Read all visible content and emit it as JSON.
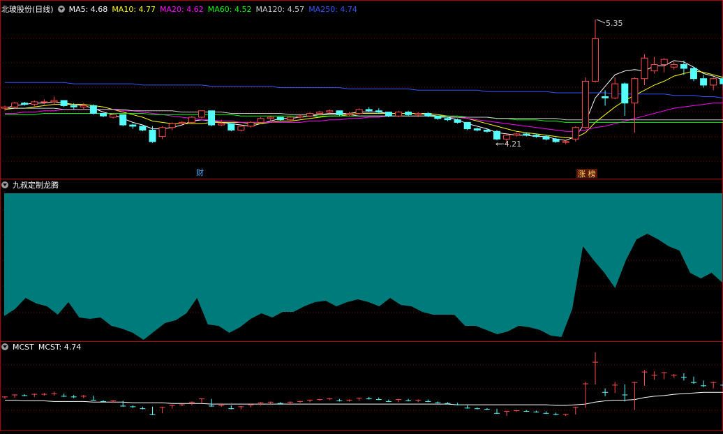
{
  "main_panel": {
    "stock_name": "北玻股份(日线)",
    "ma_items": [
      {
        "label": "MA5: 4.68",
        "color": "#ffffff"
      },
      {
        "label": "MA10: 4.77",
        "color": "#ffff00"
      },
      {
        "label": "MA20: 4.62",
        "color": "#ff00ff"
      },
      {
        "label": "MA60: 4.52",
        "color": "#00ff00"
      },
      {
        "label": "MA120: 4.57",
        "color": "#cccccc"
      },
      {
        "label": "MA250: 4.74",
        "color": "#3355ff"
      }
    ],
    "annotations": {
      "high_label": "5.35",
      "low_label": "4.21",
      "event_cai": "财",
      "event_zhangbang": "涨 榜"
    }
  },
  "mid_panel": {
    "title": "九叔定制龙腾"
  },
  "bottom_panel": {
    "title": "MCST",
    "value_label": "MCST: 4.74"
  },
  "colors": {
    "up": "#ff4b4b",
    "down": "#54ffff",
    "fill": "#007b7b",
    "grid": "#8a0000",
    "divider": "#b40000"
  },
  "chart_data": {
    "type": "candlestick",
    "price_high": 5.35,
    "price_low": 4.21,
    "ohlc": [
      [
        4.66,
        4.68,
        4.64,
        4.67
      ],
      [
        4.67,
        4.71,
        4.66,
        4.7
      ],
      [
        4.7,
        4.71,
        4.68,
        4.69
      ],
      [
        4.69,
        4.72,
        4.67,
        4.71
      ],
      [
        4.71,
        4.73,
        4.69,
        4.71
      ],
      [
        4.71,
        4.75,
        4.69,
        4.72
      ],
      [
        4.72,
        4.72,
        4.67,
        4.68
      ],
      [
        4.68,
        4.7,
        4.65,
        4.67
      ],
      [
        4.67,
        4.7,
        4.65,
        4.68
      ],
      [
        4.68,
        4.69,
        4.61,
        4.62
      ],
      [
        4.62,
        4.62,
        4.59,
        4.6
      ],
      [
        4.59,
        4.62,
        4.58,
        4.61
      ],
      [
        4.61,
        4.61,
        4.52,
        4.53
      ],
      [
        4.53,
        4.54,
        4.5,
        4.52
      ],
      [
        4.52,
        4.52,
        4.48,
        4.49
      ],
      [
        4.49,
        4.52,
        4.39,
        4.4
      ],
      [
        4.44,
        4.52,
        4.42,
        4.51
      ],
      [
        4.51,
        4.55,
        4.49,
        4.54
      ],
      [
        4.54,
        4.56,
        4.53,
        4.55
      ],
      [
        4.55,
        4.6,
        4.54,
        4.59
      ],
      [
        4.59,
        4.64,
        4.58,
        4.64
      ],
      [
        4.64,
        4.64,
        4.52,
        4.53
      ],
      [
        4.53,
        4.57,
        4.52,
        4.54
      ],
      [
        4.54,
        4.54,
        4.48,
        4.49
      ],
      [
        4.49,
        4.53,
        4.48,
        4.52
      ],
      [
        4.52,
        4.56,
        4.51,
        4.55
      ],
      [
        4.55,
        4.59,
        4.54,
        4.58
      ],
      [
        4.58,
        4.6,
        4.56,
        4.59
      ],
      [
        4.59,
        4.59,
        4.56,
        4.57
      ],
      [
        4.57,
        4.6,
        4.56,
        4.59
      ],
      [
        4.59,
        4.61,
        4.58,
        4.6
      ],
      [
        4.6,
        4.63,
        4.59,
        4.62
      ],
      [
        4.62,
        4.64,
        4.61,
        4.63
      ],
      [
        4.63,
        4.65,
        4.62,
        4.64
      ],
      [
        4.64,
        4.64,
        4.6,
        4.61
      ],
      [
        4.61,
        4.63,
        4.6,
        4.62
      ],
      [
        4.62,
        4.66,
        4.61,
        4.65
      ],
      [
        4.65,
        4.67,
        4.63,
        4.64
      ],
      [
        4.64,
        4.66,
        4.62,
        4.63
      ],
      [
        4.63,
        4.63,
        4.59,
        4.6
      ],
      [
        4.6,
        4.64,
        4.59,
        4.63
      ],
      [
        4.63,
        4.64,
        4.6,
        4.61
      ],
      [
        4.61,
        4.63,
        4.59,
        4.62
      ],
      [
        4.62,
        4.63,
        4.59,
        4.6
      ],
      [
        4.6,
        4.6,
        4.57,
        4.58
      ],
      [
        4.58,
        4.59,
        4.56,
        4.57
      ],
      [
        4.57,
        4.58,
        4.54,
        4.55
      ],
      [
        4.55,
        4.55,
        4.49,
        4.5
      ],
      [
        4.5,
        4.51,
        4.48,
        4.49
      ],
      [
        4.49,
        4.5,
        4.47,
        4.48
      ],
      [
        4.48,
        4.49,
        4.41,
        4.42
      ],
      [
        4.42,
        4.46,
        4.38,
        4.45
      ],
      [
        4.45,
        4.47,
        4.44,
        4.46
      ],
      [
        4.46,
        4.47,
        4.44,
        4.45
      ],
      [
        4.45,
        4.46,
        4.43,
        4.44
      ],
      [
        4.44,
        4.45,
        4.41,
        4.42
      ],
      [
        4.42,
        4.43,
        4.39,
        4.4
      ],
      [
        4.4,
        4.41,
        4.38,
        4.4
      ],
      [
        4.42,
        4.52,
        4.4,
        4.51
      ],
      [
        4.51,
        4.9,
        4.5,
        4.87
      ],
      [
        4.87,
        5.35,
        4.86,
        5.2
      ],
      [
        4.75,
        4.8,
        4.68,
        4.74
      ],
      [
        4.74,
        4.9,
        4.73,
        4.85
      ],
      [
        4.85,
        4.86,
        4.6,
        4.7
      ],
      [
        4.7,
        4.9,
        4.47,
        4.89
      ],
      [
        4.89,
        5.08,
        4.84,
        5.05
      ],
      [
        4.95,
        5.06,
        4.93,
        5.0
      ],
      [
        5.0,
        5.05,
        4.94,
        5.04
      ],
      [
        4.98,
        5.02,
        4.96,
        5.0
      ],
      [
        5.0,
        5.03,
        4.92,
        4.97
      ],
      [
        4.97,
        4.98,
        4.87,
        4.89
      ],
      [
        4.89,
        4.92,
        4.82,
        4.84
      ],
      [
        4.84,
        4.9,
        4.8,
        4.89
      ],
      [
        4.89,
        4.92,
        4.8,
        4.85
      ]
    ],
    "ma_values": {
      "MA5": [
        4.66,
        4.68,
        4.69,
        4.7,
        4.7,
        4.71,
        4.7,
        4.69,
        4.68,
        4.66,
        4.63,
        4.61,
        4.58,
        4.55,
        4.53,
        4.5,
        4.5,
        4.51,
        4.53,
        4.56,
        4.57,
        4.56,
        4.55,
        4.54,
        4.53,
        4.52,
        4.54,
        4.56,
        4.58,
        4.58,
        4.59,
        4.6,
        4.61,
        4.62,
        4.62,
        4.62,
        4.63,
        4.63,
        4.63,
        4.62,
        4.62,
        4.62,
        4.62,
        4.61,
        4.6,
        4.59,
        4.57,
        4.54,
        4.52,
        4.5,
        4.47,
        4.46,
        4.45,
        4.45,
        4.44,
        4.44,
        4.42,
        4.41,
        4.44,
        4.55,
        4.74,
        4.83,
        4.92,
        4.95,
        4.96,
        4.95,
        4.99,
        4.99,
        5.03,
        5.02,
        4.98,
        4.93,
        4.91,
        4.88
      ],
      "MA10": [
        4.65,
        4.66,
        4.66,
        4.67,
        4.68,
        4.69,
        4.69,
        4.69,
        4.69,
        4.68,
        4.67,
        4.65,
        4.63,
        4.61,
        4.59,
        4.56,
        4.55,
        4.54,
        4.54,
        4.54,
        4.54,
        4.55,
        4.55,
        4.55,
        4.55,
        4.54,
        4.54,
        4.55,
        4.56,
        4.56,
        4.57,
        4.58,
        4.59,
        4.6,
        4.6,
        4.61,
        4.62,
        4.62,
        4.62,
        4.62,
        4.62,
        4.62,
        4.62,
        4.62,
        4.61,
        4.6,
        4.59,
        4.58,
        4.56,
        4.54,
        4.52,
        4.5,
        4.48,
        4.47,
        4.46,
        4.45,
        4.44,
        4.43,
        4.43,
        4.47,
        4.55,
        4.61,
        4.67,
        4.72,
        4.76,
        4.8,
        4.84,
        4.87,
        4.91,
        4.93,
        4.95,
        4.94,
        4.92,
        4.9
      ],
      "MA20": [
        4.62,
        4.62,
        4.63,
        4.63,
        4.64,
        4.64,
        4.65,
        4.65,
        4.65,
        4.65,
        4.65,
        4.65,
        4.64,
        4.64,
        4.63,
        4.62,
        4.61,
        4.6,
        4.59,
        4.58,
        4.57,
        4.57,
        4.56,
        4.56,
        4.55,
        4.55,
        4.55,
        4.55,
        4.55,
        4.55,
        4.55,
        4.56,
        4.56,
        4.57,
        4.57,
        4.58,
        4.58,
        4.59,
        4.59,
        4.6,
        4.6,
        4.6,
        4.6,
        4.6,
        4.6,
        4.6,
        4.59,
        4.58,
        4.57,
        4.56,
        4.55,
        4.54,
        4.53,
        4.52,
        4.51,
        4.5,
        4.49,
        4.48,
        4.48,
        4.49,
        4.51,
        4.52,
        4.54,
        4.56,
        4.58,
        4.6,
        4.62,
        4.64,
        4.66,
        4.67,
        4.68,
        4.69,
        4.7,
        4.7
      ],
      "MA60": [
        4.61,
        4.61,
        4.61,
        4.61,
        4.62,
        4.62,
        4.62,
        4.62,
        4.62,
        4.62,
        4.62,
        4.62,
        4.62,
        4.62,
        4.62,
        4.61,
        4.61,
        4.61,
        4.61,
        4.61,
        4.61,
        4.61,
        4.61,
        4.61,
        4.6,
        4.6,
        4.6,
        4.6,
        4.6,
        4.6,
        4.6,
        4.6,
        4.6,
        4.6,
        4.6,
        4.6,
        4.6,
        4.6,
        4.6,
        4.6,
        4.6,
        4.6,
        4.6,
        4.6,
        4.6,
        4.6,
        4.6,
        4.59,
        4.59,
        4.59,
        4.58,
        4.58,
        4.57,
        4.57,
        4.57,
        4.56,
        4.56,
        4.55,
        4.55,
        4.55,
        4.55,
        4.55,
        4.55,
        4.55,
        4.55,
        4.55,
        4.55,
        4.55,
        4.55,
        4.55,
        4.55,
        4.55,
        4.55,
        4.55
      ],
      "MA120": [
        4.66,
        4.66,
        4.66,
        4.66,
        4.66,
        4.66,
        4.65,
        4.65,
        4.65,
        4.65,
        4.65,
        4.65,
        4.65,
        4.64,
        4.64,
        4.64,
        4.64,
        4.64,
        4.63,
        4.63,
        4.63,
        4.63,
        4.63,
        4.62,
        4.62,
        4.62,
        4.62,
        4.62,
        4.62,
        4.61,
        4.61,
        4.61,
        4.61,
        4.61,
        4.61,
        4.61,
        4.6,
        4.6,
        4.6,
        4.6,
        4.6,
        4.6,
        4.6,
        4.6,
        4.59,
        4.59,
        4.59,
        4.59,
        4.59,
        4.59,
        4.58,
        4.58,
        4.58,
        4.58,
        4.58,
        4.58,
        4.58,
        4.57,
        4.57,
        4.57,
        4.57,
        4.57,
        4.57,
        4.57,
        4.57,
        4.57,
        4.57,
        4.57,
        4.57,
        4.57,
        4.57,
        4.57,
        4.57,
        4.57
      ],
      "MA250": [
        4.86,
        4.86,
        4.86,
        4.86,
        4.86,
        4.86,
        4.86,
        4.85,
        4.85,
        4.85,
        4.85,
        4.85,
        4.85,
        4.85,
        4.84,
        4.84,
        4.84,
        4.84,
        4.84,
        4.84,
        4.84,
        4.83,
        4.83,
        4.83,
        4.83,
        4.83,
        4.83,
        4.83,
        4.82,
        4.82,
        4.82,
        4.82,
        4.82,
        4.82,
        4.82,
        4.81,
        4.81,
        4.81,
        4.81,
        4.81,
        4.81,
        4.81,
        4.8,
        4.8,
        4.8,
        4.8,
        4.8,
        4.8,
        4.8,
        4.79,
        4.79,
        4.79,
        4.79,
        4.79,
        4.79,
        4.79,
        4.78,
        4.78,
        4.78,
        4.78,
        4.78,
        4.78,
        4.77,
        4.77,
        4.77,
        4.77,
        4.77,
        4.77,
        4.76,
        4.76,
        4.76,
        4.75,
        4.75,
        4.74
      ]
    },
    "longteng_values": [
      0.17,
      0.22,
      0.3,
      0.26,
      0.24,
      0.18,
      0.27,
      0.16,
      0.15,
      0.16,
      0.1,
      0.08,
      0.05,
      0.0,
      0.06,
      0.12,
      0.14,
      0.19,
      0.3,
      0.11,
      0.1,
      0.05,
      0.09,
      0.15,
      0.19,
      0.16,
      0.2,
      0.2,
      0.24,
      0.27,
      0.28,
      0.24,
      0.27,
      0.29,
      0.27,
      0.24,
      0.3,
      0.25,
      0.24,
      0.2,
      0.18,
      0.18,
      0.18,
      0.1,
      0.1,
      0.07,
      0.04,
      0.06,
      0.1,
      0.09,
      0.07,
      0.03,
      0.02,
      0.22,
      0.67,
      0.57,
      0.48,
      0.37,
      0.57,
      0.72,
      0.76,
      0.72,
      0.67,
      0.64,
      0.48,
      0.44,
      0.48,
      0.41
    ],
    "mcst_values": [
      4.62,
      4.62,
      4.61,
      4.61,
      4.61,
      4.6,
      4.6,
      4.6,
      4.6,
      4.59,
      4.59,
      4.59,
      4.59,
      4.58,
      4.58,
      4.58,
      4.58,
      4.57,
      4.57,
      4.57,
      4.57,
      4.56,
      4.56,
      4.56,
      4.56,
      4.56,
      4.56,
      4.56,
      4.56,
      4.56,
      4.56,
      4.56,
      4.56,
      4.56,
      4.56,
      4.56,
      4.56,
      4.56,
      4.56,
      4.56,
      4.56,
      4.56,
      4.56,
      4.56,
      4.56,
      4.56,
      4.55,
      4.55,
      4.55,
      4.55,
      4.55,
      4.55,
      4.55,
      4.55,
      4.55,
      4.55,
      4.54,
      4.54,
      4.55,
      4.56,
      4.59,
      4.61,
      4.62,
      4.62,
      4.63,
      4.66,
      4.68,
      4.69,
      4.71,
      4.72,
      4.73,
      4.74,
      4.74,
      4.74
    ]
  }
}
